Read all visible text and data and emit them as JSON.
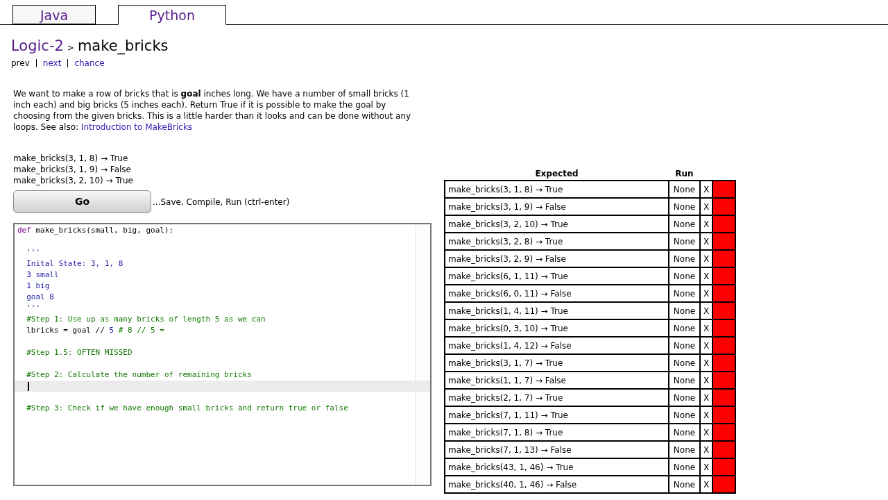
{
  "tabs": [
    {
      "label": "Java",
      "selected": false
    },
    {
      "label": "Python",
      "selected": true
    }
  ],
  "breadcrumb": {
    "section": "Logic-2",
    "separator": ">",
    "title": "make_bricks"
  },
  "nav": [
    {
      "label": "prev",
      "link": false
    },
    {
      "label": "next",
      "link": true
    },
    {
      "label": "chance",
      "link": true
    }
  ],
  "description": {
    "text": "We want to make a row of bricks that is **goal** inches long. We have a number of small bricks (1 inch each) and big bricks (5 inches each). Return True if it is possible to make the goal by choosing from the given bricks. This is a little harder than it looks and can be done without any loops. See also: ",
    "link": "Introduction to MakeBricks"
  },
  "examples": [
    "make_bricks(3, 1, 8) → True",
    "make_bricks(3, 1, 9) → False",
    "make_bricks(3, 2, 10) → True"
  ],
  "go_button": "Go",
  "go_hint": "...Save, Compile, Run (ctrl-enter)",
  "editor": {
    "lines": [
      {
        "segments": [
          {
            "kind": "keyword",
            "text": "def"
          },
          {
            "kind": "plain",
            "text": " make_bricks(small, big, goal):"
          }
        ]
      },
      {
        "kind": "blank"
      },
      {
        "segments": [
          {
            "kind": "string",
            "text": "  '''"
          }
        ]
      },
      {
        "segments": [
          {
            "kind": "string",
            "text": "  Inital State: 3, 1, 8"
          }
        ]
      },
      {
        "segments": [
          {
            "kind": "string",
            "text": "  3 small"
          }
        ]
      },
      {
        "segments": [
          {
            "kind": "string",
            "text": "  1 big"
          }
        ]
      },
      {
        "segments": [
          {
            "kind": "string",
            "text": "  goal 8"
          }
        ]
      },
      {
        "segments": [
          {
            "kind": "string",
            "text": "  '''"
          }
        ]
      },
      {
        "segments": [
          {
            "kind": "comment",
            "text": "  #Step 1: Use up as many bricks of length 5 as we can"
          }
        ]
      },
      {
        "segments": [
          {
            "kind": "plain",
            "text": "  lbricks = goal // "
          },
          {
            "kind": "number",
            "text": "5"
          },
          {
            "kind": "comment",
            "text": " # 8 // 5 ="
          }
        ]
      },
      {
        "kind": "blank"
      },
      {
        "segments": [
          {
            "kind": "comment",
            "text": "  #Step 1.5: OFTEN MISSED"
          }
        ]
      },
      {
        "kind": "blank"
      },
      {
        "segments": [
          {
            "kind": "comment",
            "text": "  #Step 2: Calculate the number of remaining bricks"
          }
        ]
      },
      {
        "kind": "cursor"
      },
      {
        "kind": "blank"
      },
      {
        "segments": [
          {
            "kind": "comment",
            "text": "  #Step 3: Check if we have enough small bricks and return true or false"
          }
        ]
      }
    ]
  },
  "results": {
    "columns": [
      "Expected",
      "Run"
    ],
    "rows": [
      {
        "expected": "make_bricks(3, 1, 8) → True",
        "run": "None",
        "mark": "X",
        "passed": false
      },
      {
        "expected": "make_bricks(3, 1, 9) → False",
        "run": "None",
        "mark": "X",
        "passed": false
      },
      {
        "expected": "make_bricks(3, 2, 10) → True",
        "run": "None",
        "mark": "X",
        "passed": false
      },
      {
        "expected": "make_bricks(3, 2, 8) → True",
        "run": "None",
        "mark": "X",
        "passed": false
      },
      {
        "expected": "make_bricks(3, 2, 9) → False",
        "run": "None",
        "mark": "X",
        "passed": false
      },
      {
        "expected": "make_bricks(6, 1, 11) → True",
        "run": "None",
        "mark": "X",
        "passed": false
      },
      {
        "expected": "make_bricks(6, 0, 11) → False",
        "run": "None",
        "mark": "X",
        "passed": false
      },
      {
        "expected": "make_bricks(1, 4, 11) → True",
        "run": "None",
        "mark": "X",
        "passed": false
      },
      {
        "expected": "make_bricks(0, 3, 10) → True",
        "run": "None",
        "mark": "X",
        "passed": false
      },
      {
        "expected": "make_bricks(1, 4, 12) → False",
        "run": "None",
        "mark": "X",
        "passed": false
      },
      {
        "expected": "make_bricks(3, 1, 7) → True",
        "run": "None",
        "mark": "X",
        "passed": false
      },
      {
        "expected": "make_bricks(1, 1, 7) → False",
        "run": "None",
        "mark": "X",
        "passed": false
      },
      {
        "expected": "make_bricks(2, 1, 7) → True",
        "run": "None",
        "mark": "X",
        "passed": false
      },
      {
        "expected": "make_bricks(7, 1, 11) → True",
        "run": "None",
        "mark": "X",
        "passed": false
      },
      {
        "expected": "make_bricks(7, 1, 8) → True",
        "run": "None",
        "mark": "X",
        "passed": false
      },
      {
        "expected": "make_bricks(7, 1, 13) → False",
        "run": "None",
        "mark": "X",
        "passed": false
      },
      {
        "expected": "make_bricks(43, 1, 46) → True",
        "run": "None",
        "mark": "X",
        "passed": false
      },
      {
        "expected": "make_bricks(40, 1, 46) → False",
        "run": "None",
        "mark": "X",
        "passed": false
      }
    ]
  }
}
